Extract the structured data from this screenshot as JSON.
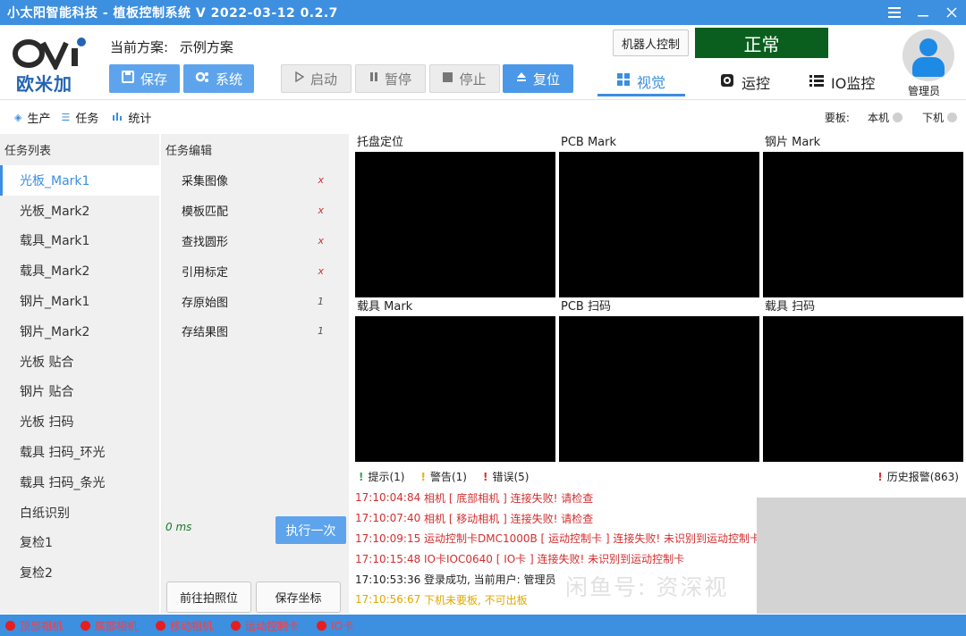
{
  "window": {
    "title": "小太阳智能科技 - 植板控制系统  V 2022-03-12 0.2.7",
    "menu_icon": "menu-icon",
    "min_icon": "minimize-icon",
    "close_icon": "close-icon"
  },
  "header": {
    "logo_text": "欧米加",
    "plan_label": "当前方案:",
    "plan_value": "示例方案",
    "buttons": {
      "save": "保存",
      "system": "系统",
      "start": "启动",
      "pause": "暂停",
      "stop": "停止",
      "reset": "复位"
    },
    "robot_control": "机器人控制",
    "status": "正常",
    "tabs": [
      {
        "label": "视觉",
        "icon": "windows-icon"
      },
      {
        "label": "运控",
        "icon": "camera-icon"
      },
      {
        "label": "IO监控",
        "icon": "list-icon"
      }
    ],
    "user": "管理员",
    "colors": {
      "accent": "#3d8fe0",
      "status_bg": "#0b5f1e"
    }
  },
  "subbar": {
    "items": [
      {
        "label": "生产",
        "icon": "layers-icon"
      },
      {
        "label": "任务",
        "icon": "list-icon"
      },
      {
        "label": "统计",
        "icon": "bar-chart-icon"
      }
    ],
    "board_label": "要板:",
    "local": "本机",
    "down": "下机"
  },
  "tasklist": {
    "title": "任务列表",
    "items": [
      "光板_Mark1",
      "光板_Mark2",
      "载具_Mark1",
      "载具_Mark2",
      "钢片_Mark1",
      "钢片_Mark2",
      "光板 贴合",
      "钢片 贴合",
      "光板 扫码",
      "载具 扫码_环光",
      "载具 扫码_条光",
      "白纸识别",
      "复检1",
      "复检2"
    ]
  },
  "editor": {
    "title": "任务编辑",
    "items": [
      {
        "label": "采集图像",
        "mark": "x"
      },
      {
        "label": "模板匹配",
        "mark": "x"
      },
      {
        "label": "查找圆形",
        "mark": "x"
      },
      {
        "label": "引用标定",
        "mark": "x"
      },
      {
        "label": "存原始图",
        "mark": "1"
      },
      {
        "label": "存结果图",
        "mark": "1"
      }
    ],
    "time": "0 ms",
    "exec": "执行一次",
    "goto": "前往拍照位",
    "save_coord": "保存坐标"
  },
  "views": [
    "托盘定位",
    "PCB Mark",
    "钢片 Mark",
    "载具 Mark",
    "PCB 扫码",
    "载具 扫码"
  ],
  "log": {
    "tabs": {
      "info": "提示(1)",
      "warn": "警告(1)",
      "error": "错误(5)",
      "history": "历史报警(863)"
    },
    "lines": [
      {
        "time": "17:10:04:84",
        "text": "相机 [ 底部相机 ] 连接失败! 请检查",
        "level": "err"
      },
      {
        "time": "17:10:07:40",
        "text": "相机 [ 移动相机 ] 连接失败! 请检查",
        "level": "err"
      },
      {
        "time": "17:10:09:15",
        "text": "运动控制卡DMC1000B [ 运动控制卡 ] 连接失败! 未识别到运动控制卡",
        "level": "err"
      },
      {
        "time": "17:10:15:48",
        "text": "IO卡IOC0640 [ IO卡 ] 连接失败! 未识别到运动控制卡",
        "level": "err"
      },
      {
        "time": "17:10:53:36",
        "text": "登录成功, 当前用户: 管理员",
        "level": "info"
      },
      {
        "time": "17:10:56:67",
        "text": "下机未要板, 不可出板",
        "level": "warn"
      }
    ],
    "watermark": "闲鱼号: 资深视"
  },
  "statusbar": [
    "顶部相机",
    "底部相机",
    "移动相机",
    "运动控制卡",
    "IO卡"
  ]
}
